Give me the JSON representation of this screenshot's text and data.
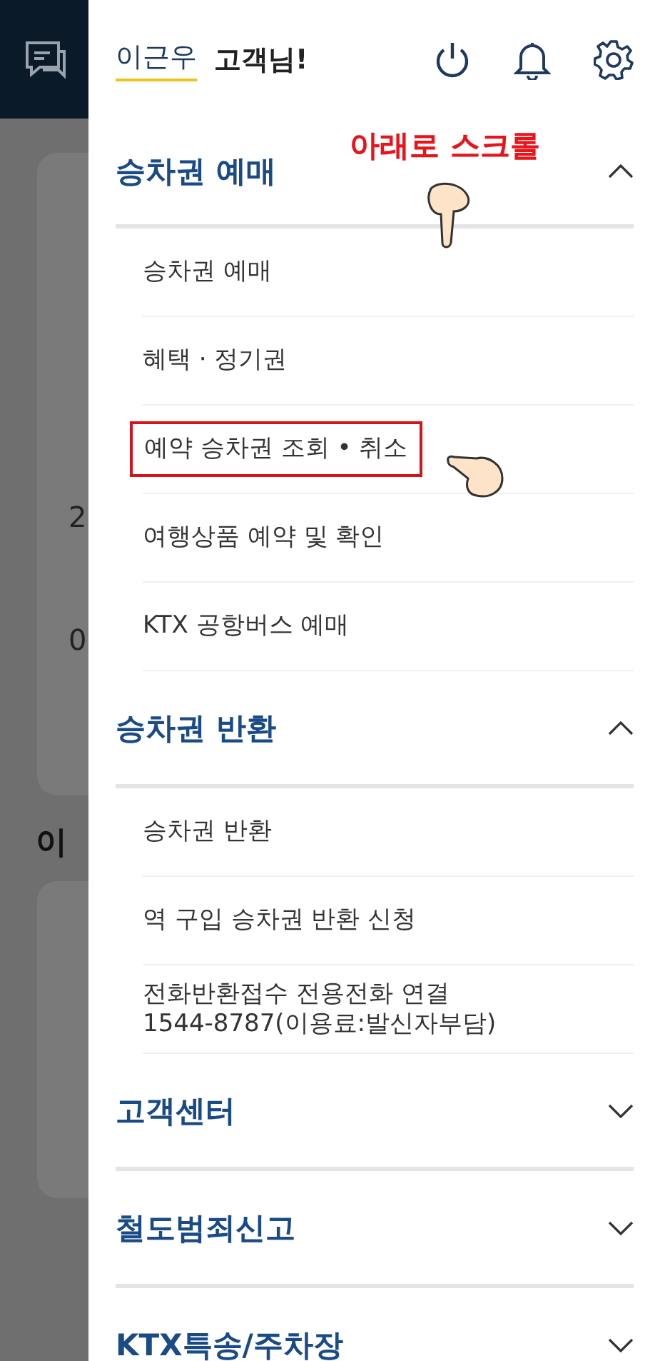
{
  "background": {
    "fragments": [
      {
        "kind": "value",
        "text": "2"
      },
      {
        "kind": "value",
        "text": "0"
      },
      {
        "kind": "heading",
        "text": "이"
      }
    ]
  },
  "user": {
    "name": "이근우",
    "suffix": "고객님!"
  },
  "annotation": {
    "text": "아래로 스크롤"
  },
  "sections": [
    {
      "title": "승차권 예매",
      "expanded": true,
      "items": [
        {
          "label": "승차권 예매",
          "highlighted": false
        },
        {
          "label": "혜택 · 정기권",
          "highlighted": false
        },
        {
          "label": "예약 승차권 조회 • 취소",
          "highlighted": true
        },
        {
          "label": "여행상품 예약 및 확인",
          "highlighted": false
        },
        {
          "label": "KTX 공항버스 예매",
          "highlighted": false
        }
      ]
    },
    {
      "title": "승차권 반환",
      "expanded": true,
      "items": [
        {
          "label": "승차권 반환",
          "highlighted": false
        },
        {
          "label": "역 구입 승차권 반환 신청",
          "highlighted": false
        },
        {
          "label": "전화반환접수 전용전화 연결\n1544-8787(이용료:발신자부담)",
          "highlighted": false
        }
      ]
    },
    {
      "title": "고객센터",
      "expanded": false
    },
    {
      "title": "철도범죄신고",
      "expanded": false
    },
    {
      "title": "KTX특송/주차장",
      "expanded": false
    }
  ]
}
